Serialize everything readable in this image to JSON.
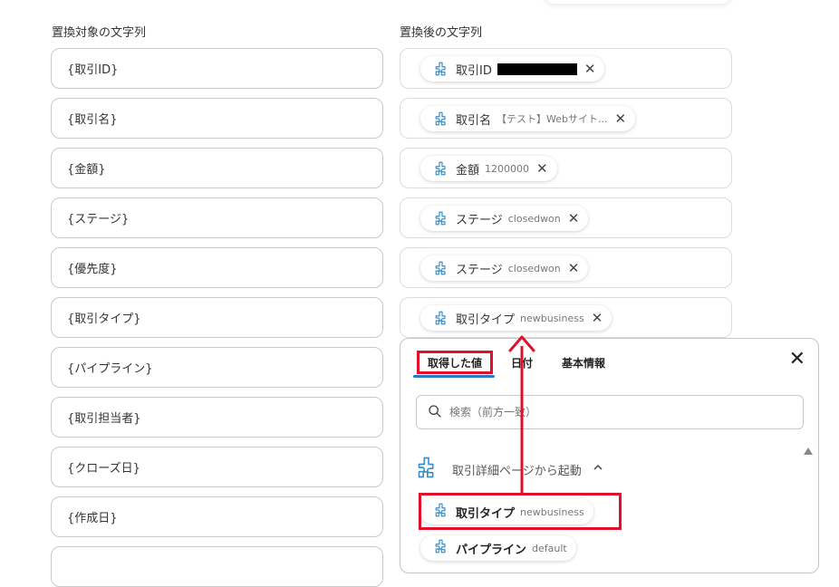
{
  "headers": {
    "left": "置換対象の文字列",
    "right": "置換後の文字列"
  },
  "left_fields": [
    "{取引ID}",
    "{取引名}",
    "{金額}",
    "{ステージ}",
    "{優先度}",
    "{取引タイプ}",
    "{パイプライン}",
    "{取引担当者}",
    "{クローズ日}",
    "{作成日}"
  ],
  "right_fields": [
    {
      "label": "取引ID",
      "value": ""
    },
    {
      "label": "取引名",
      "value": "【テスト】Webサイト..."
    },
    {
      "label": "金額",
      "value": "1200000"
    },
    {
      "label": "ステージ",
      "value": "closedwon"
    },
    {
      "label": "ステージ",
      "value": "closedwon"
    },
    {
      "label": "取引タイプ",
      "value": "newbusiness"
    }
  ],
  "close_glyph": "✕",
  "popover": {
    "tabs": [
      "取得した値",
      "日付",
      "基本情報"
    ],
    "active_tab": "取得した値",
    "close_glyph": "✕",
    "search_placeholder": "検索（前方一致）",
    "section_title": "取引詳細ページから起動",
    "items": [
      {
        "label": "取引タイプ",
        "value": "newbusiness"
      },
      {
        "label": "パイプライン",
        "value": "default"
      }
    ]
  },
  "icons": {
    "chip": "puzzle-icon",
    "search": "search-icon",
    "collapse": "chevron-up-icon"
  },
  "colors": {
    "accent": "#2a7bbd",
    "highlight": "#e0102c",
    "icon": "#3a8fc9"
  }
}
